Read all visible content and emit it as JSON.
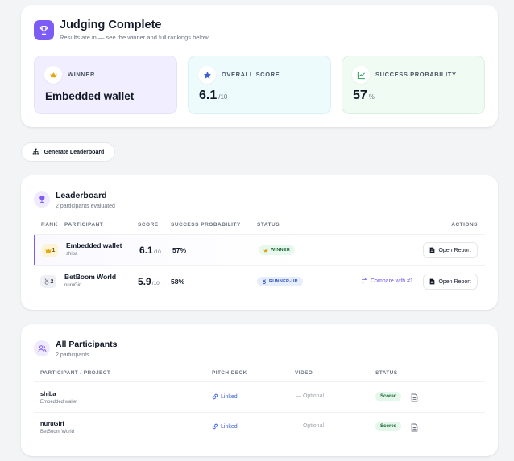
{
  "hero": {
    "title": "Judging Complete",
    "subtitle": "Results are in — see the winner and full rankings below",
    "icon": "trophy-icon",
    "winner": {
      "label": "WINNER",
      "value": "Embedded wallet",
      "icon": "crown-icon"
    },
    "score": {
      "label": "OVERALL SCORE",
      "value": "6.1",
      "unit": "/10",
      "icon": "star-icon"
    },
    "probability": {
      "label": "SUCCESS PROBABILITY",
      "value": "57",
      "unit": "%",
      "icon": "chart-icon"
    }
  },
  "generate_button": {
    "label": "Generate Leaderboard",
    "icon": "hierarchy-icon"
  },
  "leaderboard": {
    "title": "Leaderboard",
    "subtitle": "2 participants evaluated",
    "columns": {
      "rank": "RANK",
      "participant": "PARTICIPANT",
      "score": "SCORE",
      "probability": "SUCCESS PROBABILITY",
      "status": "STATUS",
      "actions": "ACTIONS"
    },
    "rows": [
      {
        "rank": "1",
        "name": "Embedded wallet",
        "user": "shiba",
        "score": "6.1",
        "score_unit": "/10",
        "probability": "57%",
        "status": "WINNER",
        "compare": "",
        "action": "Open Report"
      },
      {
        "rank": "2",
        "name": "BetBoom World",
        "user": "nuruGirl",
        "score": "5.9",
        "score_unit": "/10",
        "probability": "58%",
        "status": "RUNNER-UP",
        "compare": "Compare with #1",
        "action": "Open Report"
      }
    ]
  },
  "participants": {
    "title": "All Participants",
    "subtitle": "2 participants",
    "columns": {
      "participant": "PARTICIPANT / PROJECT",
      "deck": "PITCH DECK",
      "video": "VIDEO",
      "status": "STATUS"
    },
    "rows": [
      {
        "name": "shiba",
        "project": "Embedded wallet",
        "deck": "Linked",
        "video": "— Optional",
        "status": "Scored"
      },
      {
        "name": "nuruGirl",
        "project": "BetBoom World",
        "deck": "Linked",
        "video": "— Optional",
        "status": "Scored"
      }
    ]
  },
  "colors": {
    "accent": "#7c5cf5",
    "winner_bg": "#f1efff",
    "score_bg": "#eefbfd",
    "probability_bg": "#effbf3",
    "success": "#166534",
    "link": "#3b5fd6"
  }
}
